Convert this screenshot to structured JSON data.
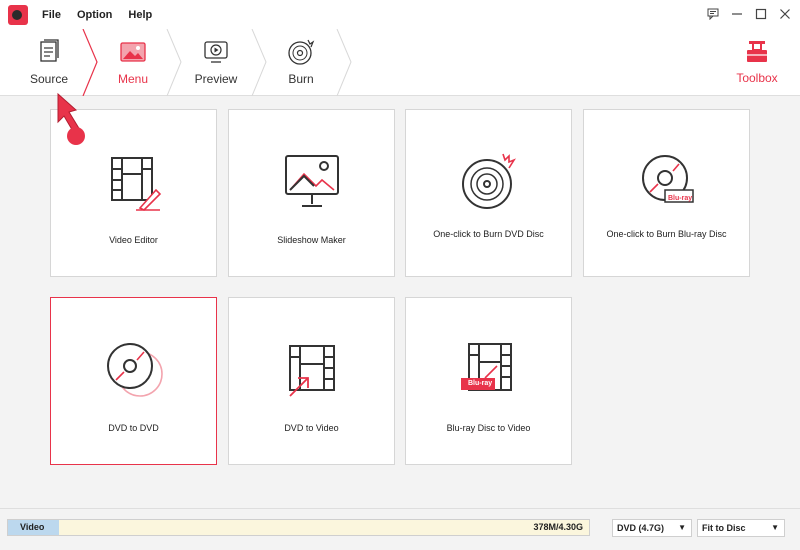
{
  "menubar": {
    "file": "File",
    "option": "Option",
    "help": "Help"
  },
  "steps": {
    "source": "Source",
    "menu": "Menu",
    "preview": "Preview",
    "burn": "Burn",
    "toolbox": "Toolbox"
  },
  "tiles": [
    {
      "label": "Video Editor"
    },
    {
      "label": "Slideshow Maker"
    },
    {
      "label": "One-click to Burn DVD Disc"
    },
    {
      "label": "One-click to Burn Blu-ray Disc"
    },
    {
      "label": "DVD to DVD"
    },
    {
      "label": "DVD to Video"
    },
    {
      "label": "Blu-ray Disc to Video"
    }
  ],
  "badges": {
    "bluray_1": "Blu-ray",
    "bluray_2": "Blu-ray"
  },
  "capacity": {
    "label": "Video",
    "used": "378M/4.30G",
    "fill_fraction": 0.087
  },
  "disc_type": "DVD (4.7G)",
  "fit_mode": "Fit to Disc",
  "colors": {
    "accent": "#e8334a",
    "capacity_fill": "#bcd8ee",
    "capacity_bg": "#fbf6dd"
  }
}
